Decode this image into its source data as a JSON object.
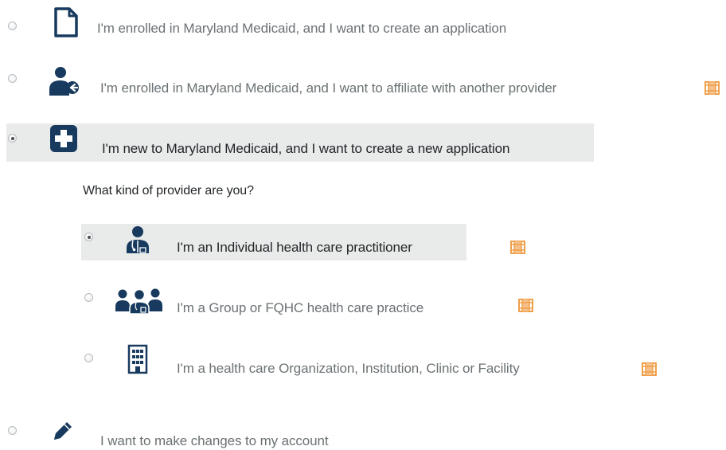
{
  "options": {
    "create_application": {
      "label": "I'm enrolled in Maryland Medicaid, and I want to create an application",
      "icon": "document-icon",
      "selected": false
    },
    "affiliate": {
      "label": "I'm enrolled in Maryland Medicaid, and I want to affiliate with another provider",
      "icon": "user-arrow-icon",
      "selected": false
    },
    "new_application": {
      "label": "I'm new to Maryland Medicaid, and I want to create a new application",
      "icon": "medical-cross-icon",
      "selected": true
    },
    "make_changes": {
      "label": "I want to make changes to my account",
      "icon": "pencil-icon",
      "selected": false
    }
  },
  "provider_question": "What kind of provider are you?",
  "provider_types": {
    "individual": {
      "label": "I'm an Individual health care practitioner",
      "icon": "doctor-icon",
      "selected": true
    },
    "group": {
      "label": "I'm a Group or FQHC health care practice",
      "icon": "group-doctors-icon",
      "selected": false
    },
    "organization": {
      "label": "I'm a health care Organization, Institution, Clinic or Facility",
      "icon": "building-icon",
      "selected": false
    }
  },
  "colors": {
    "icon_navy": "#173a5e",
    "film_orange": "#f0a04b",
    "selected_bg": "#e9eaea",
    "text_gray": "#6b7174",
    "text_dark": "#222629"
  }
}
